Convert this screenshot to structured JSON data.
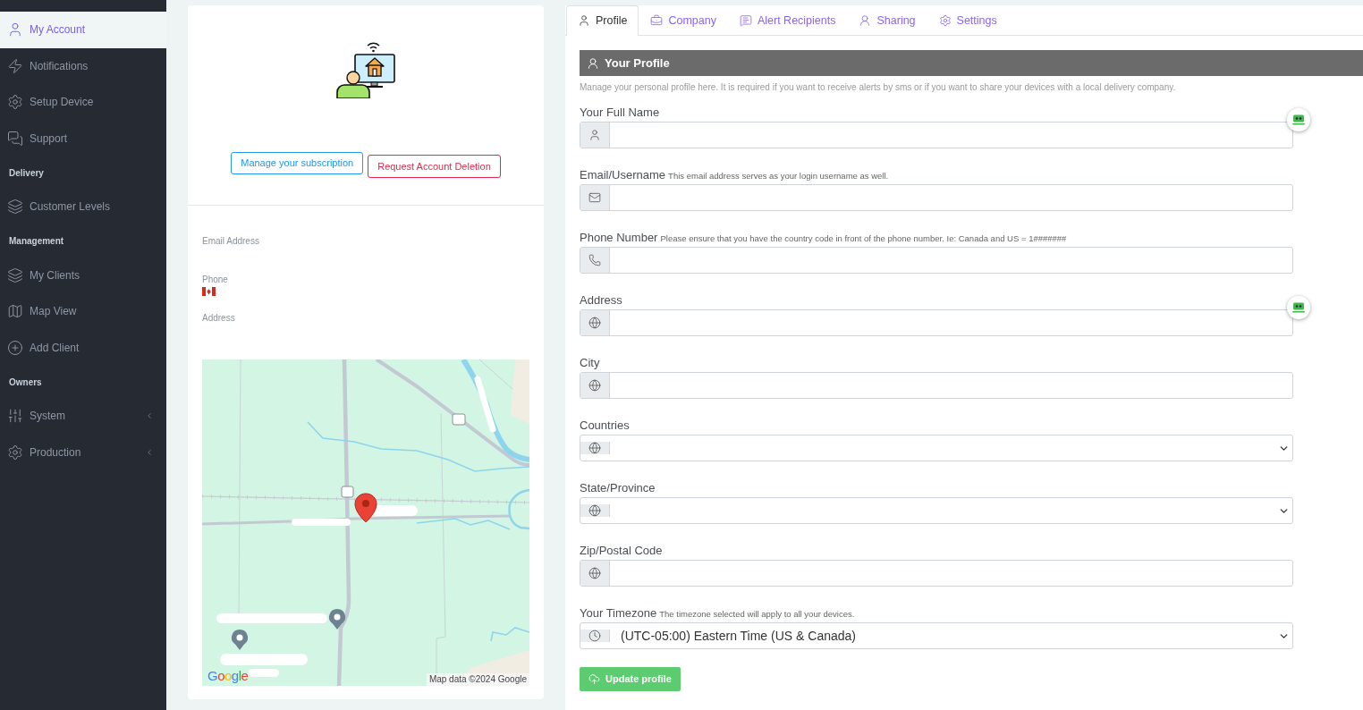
{
  "sidebar": {
    "items": [
      {
        "kind": "item",
        "label": "My Account",
        "selected": true
      },
      {
        "kind": "item",
        "label": "Notifications",
        "selected": false
      },
      {
        "kind": "item",
        "label": "Setup Device",
        "selected": false
      },
      {
        "kind": "item",
        "label": "Support",
        "selected": false
      },
      {
        "kind": "section",
        "label": "Delivery"
      },
      {
        "kind": "item",
        "label": "Customer Levels",
        "selected": false
      },
      {
        "kind": "section",
        "label": "Management"
      },
      {
        "kind": "item",
        "label": "My Clients",
        "selected": false
      },
      {
        "kind": "item",
        "label": "Map View",
        "selected": false
      },
      {
        "kind": "item",
        "label": "Add Client",
        "selected": false
      },
      {
        "kind": "section",
        "label": "Owners"
      },
      {
        "kind": "group",
        "label": "System",
        "selected": false,
        "expanded": false
      },
      {
        "kind": "group",
        "label": "Production",
        "selected": false,
        "expanded": false
      }
    ]
  },
  "account_card": {
    "buttons": [
      {
        "kind": "primary",
        "label": "Manage your subscription"
      },
      {
        "kind": "danger",
        "label": "Request Account Deletion"
      }
    ],
    "details": [
      {
        "kind": "plain",
        "label": "Email Address"
      },
      {
        "kind": "phone",
        "label": "Phone"
      },
      {
        "kind": "plain",
        "label": "Address"
      }
    ],
    "map": {
      "logo": "Google",
      "attribution": "Map data ©2024 Google"
    }
  },
  "tabs": [
    {
      "label": "Profile",
      "selected": true
    },
    {
      "label": "Company",
      "selected": false
    },
    {
      "label": "Alert Recipients",
      "selected": false
    },
    {
      "label": "Sharing",
      "selected": false
    },
    {
      "label": "Settings",
      "selected": false
    }
  ],
  "profile": {
    "title": "Your Profile",
    "description": "Manage your personal profile here. It is required if you want to receive alerts by sms or if you want to share your devices with a local delivery company.",
    "fields": [
      {
        "kind": "text",
        "label": "Your Full Name",
        "assist_badge": true
      },
      {
        "kind": "text",
        "label": "Email/Username",
        "hint": "This email address serves as your login username as well.",
        "assist_badge": false
      },
      {
        "kind": "text",
        "label": "Phone Number",
        "hint": "Please ensure that you have the country code in front of the phone number. Ie: Canada and US = 1#######",
        "assist_badge": false
      },
      {
        "kind": "text",
        "label": "Address",
        "assist_badge": true
      },
      {
        "kind": "text",
        "label": "City",
        "assist_badge": false
      },
      {
        "kind": "select",
        "label": "Countries",
        "assist_badge": false
      },
      {
        "kind": "select",
        "label": "State/Province",
        "assist_badge": false
      },
      {
        "kind": "text",
        "label": "Zip/Postal Code",
        "assist_badge": false
      },
      {
        "kind": "select",
        "label": "Your Timezone",
        "hint": "The timezone selected will apply to all your devices.",
        "value": "(UTC-05:00) Eastern Time (US & Canada)",
        "assist_badge": false
      }
    ],
    "submit": "Update profile"
  }
}
